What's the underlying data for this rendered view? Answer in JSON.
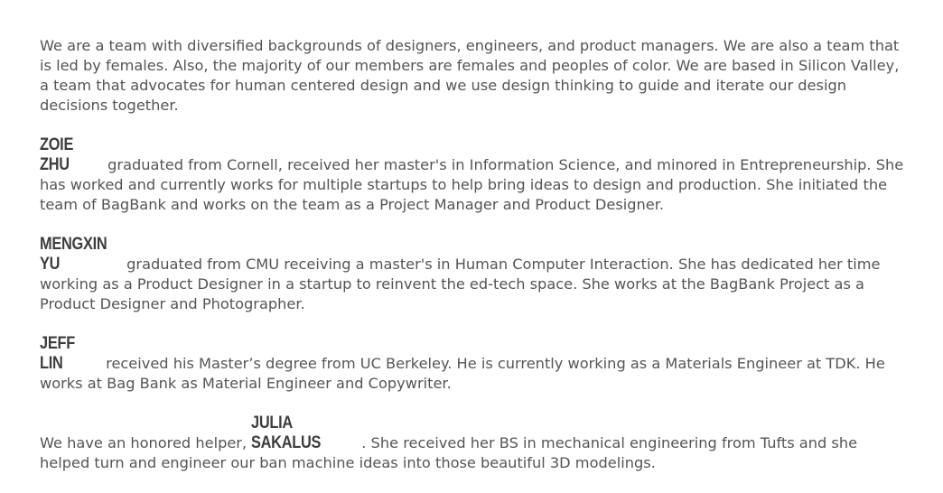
{
  "intro": "We are a team with diversified backgrounds of designers, engineers, and product managers. We are also a team that is led by females. Also, the majority of our members are females and peoples of color. We are based in Silicon Valley, a team that advocates for human centered design and we use design thinking to guide and iterate our design decisions together.",
  "members": [
    {
      "name": "ZOIE ZHU",
      "bio": " graduated from Cornell, received her master's in Information Science, and minored in Entrepreneurship. She has worked and currently works for multiple startups to help bring ideas to design and production. She initiated the team of BagBank and works on the team as a Project Manager and Product Designer."
    },
    {
      "name": "MENGXIN YU",
      "bio": " graduated from CMU receiving a master's in Human Computer Interaction. She has dedicated her time working as a Product Designer in a startup to reinvent the ed-tech space. She works at the BagBank Project as a Product Designer and Photographer."
    },
    {
      "name": "JEFF LIN",
      "bio": " received his Master’s degree  from UC Berkeley. He is currently working as a Materials Engineer at TDK. He works at Bag Bank as Material Engineer and Copywriter."
    }
  ],
  "helper": {
    "prefix": "We have an honored helper, ",
    "name": "JULIA SAKALUS",
    "suffix": ". She received her BS in mechanical engineering from Tufts and she helped turn and engineer our ban machine ideas into those beautiful 3D modelings."
  }
}
